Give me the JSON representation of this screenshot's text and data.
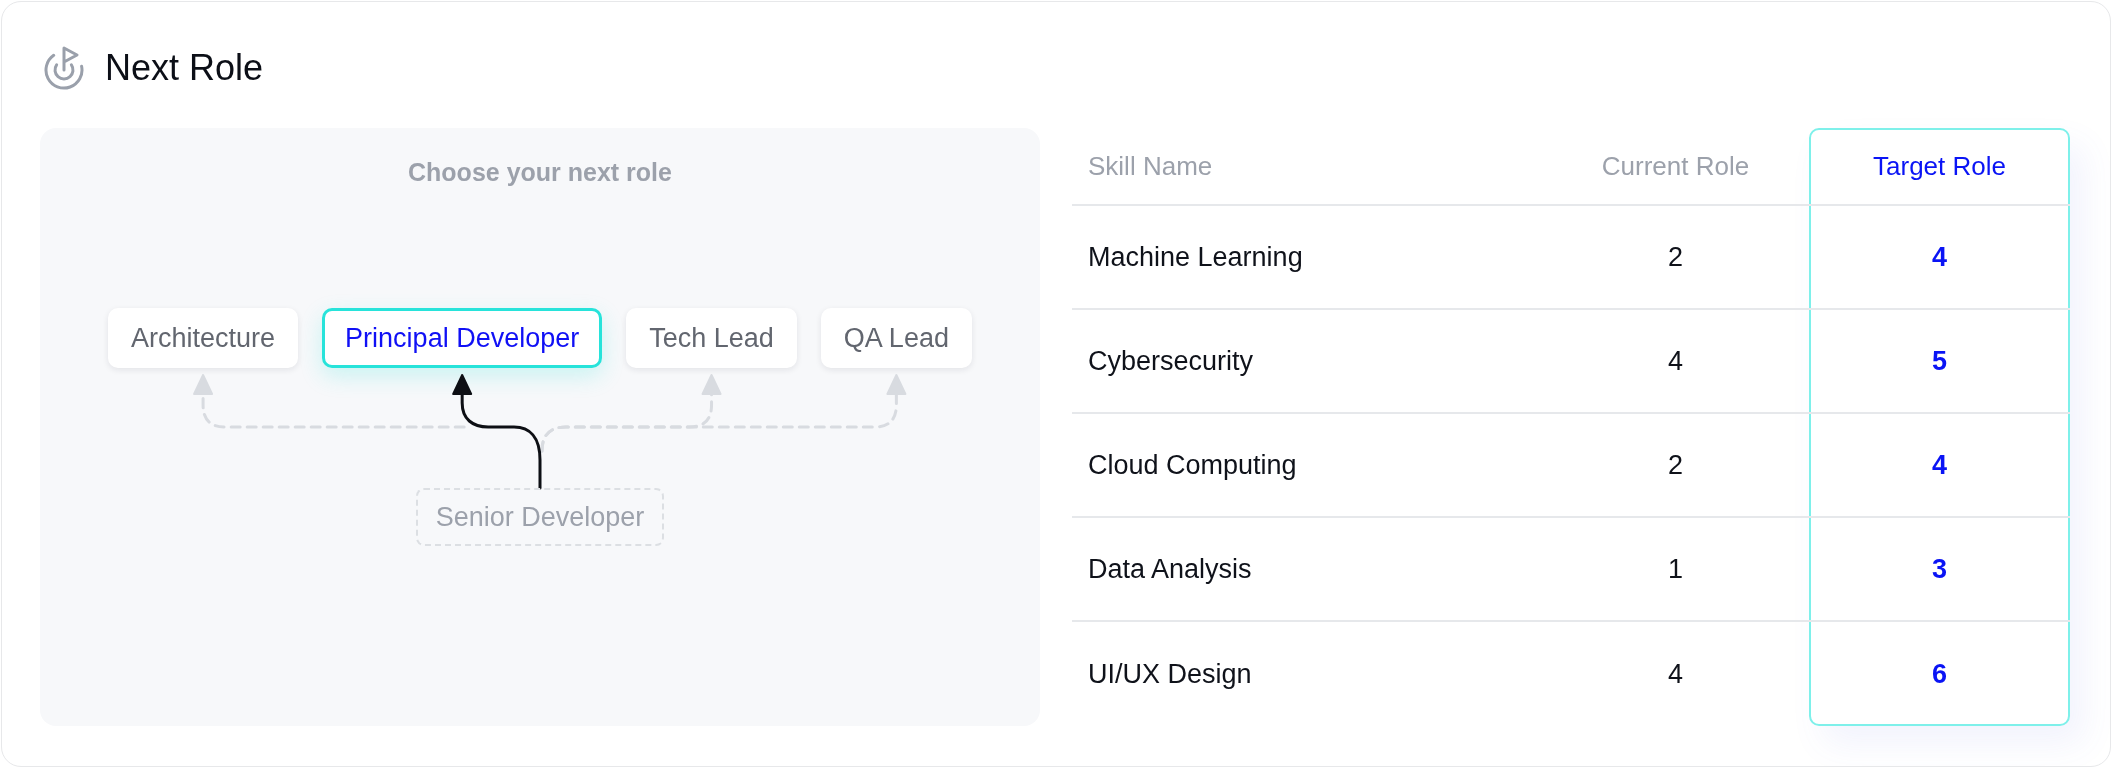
{
  "header": {
    "title": "Next Role"
  },
  "role_chooser": {
    "title": "Choose your next role",
    "options": [
      {
        "label": "Architecture",
        "selected": false
      },
      {
        "label": "Principal Developer",
        "selected": true
      },
      {
        "label": "Tech Lead",
        "selected": false
      },
      {
        "label": "QA Lead",
        "selected": false
      }
    ],
    "current_role": {
      "label": "Senior Developer"
    }
  },
  "table": {
    "columns": [
      {
        "label": "Skill Name",
        "highlighted": false
      },
      {
        "label": "Current Role",
        "highlighted": false
      },
      {
        "label": "Target Role",
        "highlighted": true
      }
    ],
    "rows": [
      {
        "cells": [
          "Machine Learning",
          "2",
          "4"
        ]
      },
      {
        "cells": [
          "Cybersecurity",
          "4",
          "5"
        ]
      },
      {
        "cells": [
          "Cloud Computing",
          "2",
          "4"
        ]
      },
      {
        "cells": [
          "Data Analysis",
          "1",
          "3"
        ]
      },
      {
        "cells": [
          "UI/UX Design",
          "4",
          "6"
        ]
      }
    ]
  }
}
